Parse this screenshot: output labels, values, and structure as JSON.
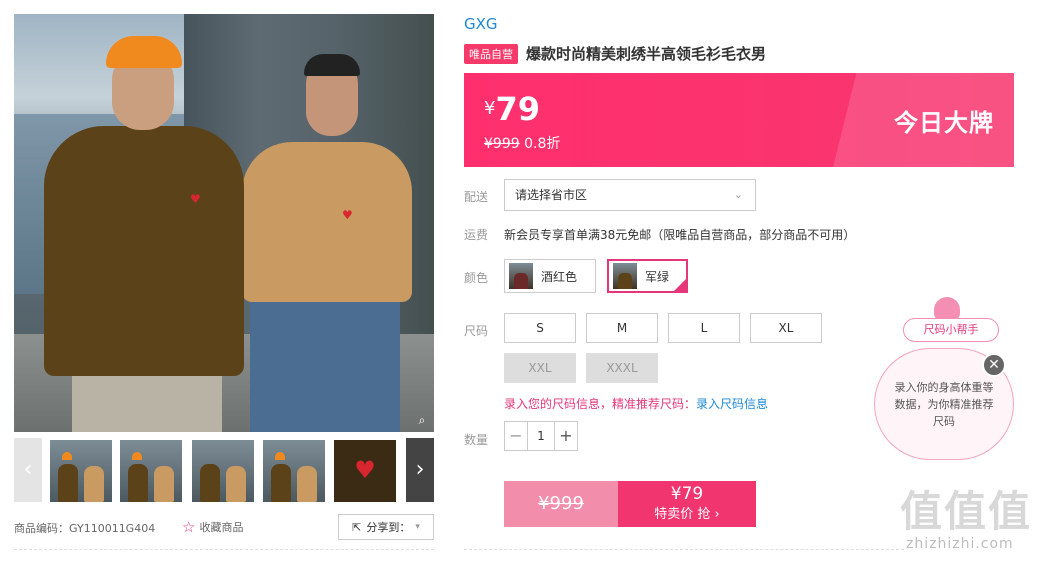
{
  "product": {
    "brand": "GXG",
    "self_tag": "唯品自营",
    "title": "爆款时尚精美刺绣半高领毛衫毛衣男",
    "sku_label": "商品编码：GY110011G404",
    "favorite_label": "收藏商品",
    "share_label": "分享到："
  },
  "price": {
    "currency": "¥",
    "current": "79",
    "original": "¥999",
    "discount": "0.8折",
    "badge": "今日大牌"
  },
  "delivery": {
    "label": "配送",
    "placeholder": "请选择省市区"
  },
  "shipping": {
    "label": "运费",
    "text": "新会员专享首单满38元免邮（限唯品自营商品，部分商品不可用）"
  },
  "color": {
    "label": "颜色",
    "options": [
      "酒红色",
      "军绿"
    ],
    "selected": "军绿"
  },
  "size": {
    "label": "尺码",
    "options": [
      "S",
      "M",
      "L",
      "XL",
      "XXL",
      "XXXL"
    ],
    "disabled": [
      "XXL",
      "XXXL"
    ],
    "hint": "录入您的尺码信息，精准推荐尺码：",
    "hint_link": "录入尺码信息"
  },
  "quantity": {
    "label": "数量",
    "value": "1",
    "minus": "−",
    "plus": "+"
  },
  "buy": {
    "original": "¥999",
    "price": "¥79",
    "action": "特卖价 抢 ›"
  },
  "size_helper": {
    "tag": "尺码小帮手",
    "text": "录入你的身高体重等数据，为你精准推荐尺码"
  },
  "gallery": {
    "prev": "‹",
    "next": "›",
    "zoom": "⌕"
  },
  "watermark": {
    "main": "值值值",
    "sub": "zhizhizhi.com"
  },
  "icons": {
    "favorite": "star-outline-icon",
    "share": "share-icon",
    "dropdown": "chevron-down-icon",
    "close": "close-icon"
  },
  "colors": {
    "accent": "#f53a6a",
    "brand_link": "#1e88d6",
    "pink": "#e5357b"
  }
}
